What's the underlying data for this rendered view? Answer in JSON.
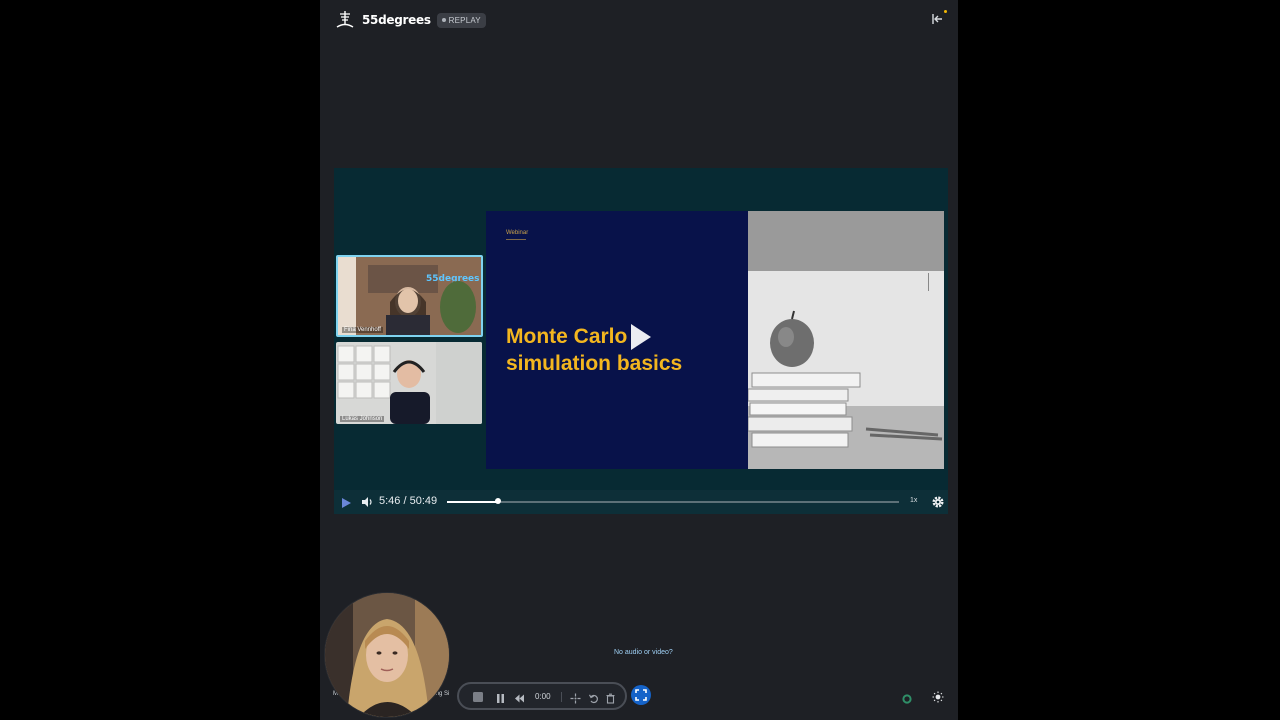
{
  "header": {
    "brand": "55degrees",
    "badge": "REPLAY",
    "exit_icon": "exit-arrow-icon"
  },
  "colors": {
    "app_bg": "#1e2025",
    "player_bg": "#072a33",
    "slide_bg": "#08124a",
    "slide_title": "#f3b61f",
    "accent_blue": "#1563c9",
    "link": "#9fd0f5"
  },
  "video": {
    "participants": [
      {
        "name": "Fina Vennhoff"
      },
      {
        "name": "Lukas Johnson"
      }
    ],
    "slide": {
      "tag": "Webinar",
      "title": "Monte Carlo\nsimulation basics"
    },
    "controls": {
      "current_time": "5:46",
      "separator": "/",
      "duration": "50:49",
      "progress_fraction": 0.113,
      "speed": "1x"
    }
  },
  "footer": {
    "no_av_link": "No audio or video?",
    "left_label_1": "M",
    "left_label_2": "aking Si",
    "recorder": {
      "time": "0:00"
    }
  }
}
